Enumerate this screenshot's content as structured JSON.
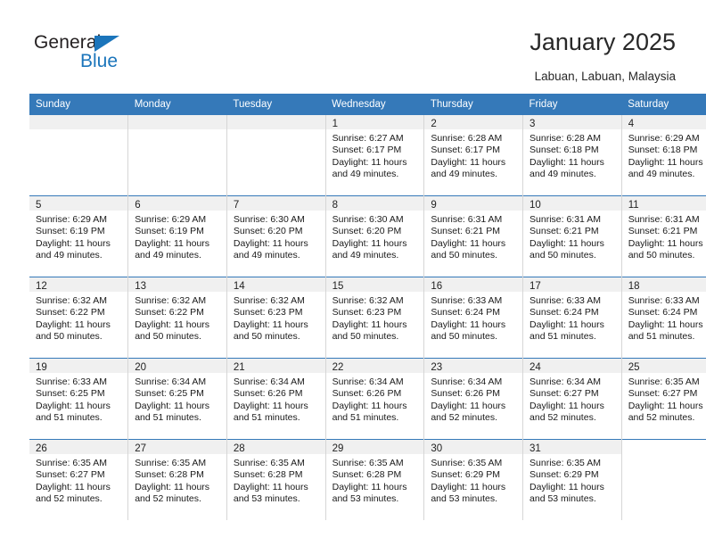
{
  "brand": {
    "name_part1": "General",
    "name_part2": "Blue",
    "triangle_icon": "triangle-icon",
    "accent_color": "#1b75bb"
  },
  "header": {
    "title": "January 2025",
    "location": "Labuan, Labuan, Malaysia"
  },
  "colors": {
    "header_blue": "#3579b9",
    "daynum_band": "#f0f0f0",
    "separator_blue": "#3579b9",
    "cell_divider": "#d6d6d6"
  },
  "weekday_headers": [
    "Sunday",
    "Monday",
    "Tuesday",
    "Wednesday",
    "Thursday",
    "Friday",
    "Saturday"
  ],
  "weeks": [
    [
      {
        "day": "",
        "sunrise": "",
        "sunset": "",
        "daylight_line1": "",
        "daylight_line2": "",
        "blank": true
      },
      {
        "day": "",
        "sunrise": "",
        "sunset": "",
        "daylight_line1": "",
        "daylight_line2": "",
        "blank": true
      },
      {
        "day": "",
        "sunrise": "",
        "sunset": "",
        "daylight_line1": "",
        "daylight_line2": "",
        "blank": true
      },
      {
        "day": "1",
        "sunrise": "Sunrise: 6:27 AM",
        "sunset": "Sunset: 6:17 PM",
        "daylight_line1": "Daylight: 11 hours",
        "daylight_line2": "and 49 minutes."
      },
      {
        "day": "2",
        "sunrise": "Sunrise: 6:28 AM",
        "sunset": "Sunset: 6:17 PM",
        "daylight_line1": "Daylight: 11 hours",
        "daylight_line2": "and 49 minutes."
      },
      {
        "day": "3",
        "sunrise": "Sunrise: 6:28 AM",
        "sunset": "Sunset: 6:18 PM",
        "daylight_line1": "Daylight: 11 hours",
        "daylight_line2": "and 49 minutes."
      },
      {
        "day": "4",
        "sunrise": "Sunrise: 6:29 AM",
        "sunset": "Sunset: 6:18 PM",
        "daylight_line1": "Daylight: 11 hours",
        "daylight_line2": "and 49 minutes."
      }
    ],
    [
      {
        "day": "5",
        "sunrise": "Sunrise: 6:29 AM",
        "sunset": "Sunset: 6:19 PM",
        "daylight_line1": "Daylight: 11 hours",
        "daylight_line2": "and 49 minutes."
      },
      {
        "day": "6",
        "sunrise": "Sunrise: 6:29 AM",
        "sunset": "Sunset: 6:19 PM",
        "daylight_line1": "Daylight: 11 hours",
        "daylight_line2": "and 49 minutes."
      },
      {
        "day": "7",
        "sunrise": "Sunrise: 6:30 AM",
        "sunset": "Sunset: 6:20 PM",
        "daylight_line1": "Daylight: 11 hours",
        "daylight_line2": "and 49 minutes."
      },
      {
        "day": "8",
        "sunrise": "Sunrise: 6:30 AM",
        "sunset": "Sunset: 6:20 PM",
        "daylight_line1": "Daylight: 11 hours",
        "daylight_line2": "and 49 minutes."
      },
      {
        "day": "9",
        "sunrise": "Sunrise: 6:31 AM",
        "sunset": "Sunset: 6:21 PM",
        "daylight_line1": "Daylight: 11 hours",
        "daylight_line2": "and 50 minutes."
      },
      {
        "day": "10",
        "sunrise": "Sunrise: 6:31 AM",
        "sunset": "Sunset: 6:21 PM",
        "daylight_line1": "Daylight: 11 hours",
        "daylight_line2": "and 50 minutes."
      },
      {
        "day": "11",
        "sunrise": "Sunrise: 6:31 AM",
        "sunset": "Sunset: 6:21 PM",
        "daylight_line1": "Daylight: 11 hours",
        "daylight_line2": "and 50 minutes."
      }
    ],
    [
      {
        "day": "12",
        "sunrise": "Sunrise: 6:32 AM",
        "sunset": "Sunset: 6:22 PM",
        "daylight_line1": "Daylight: 11 hours",
        "daylight_line2": "and 50 minutes."
      },
      {
        "day": "13",
        "sunrise": "Sunrise: 6:32 AM",
        "sunset": "Sunset: 6:22 PM",
        "daylight_line1": "Daylight: 11 hours",
        "daylight_line2": "and 50 minutes."
      },
      {
        "day": "14",
        "sunrise": "Sunrise: 6:32 AM",
        "sunset": "Sunset: 6:23 PM",
        "daylight_line1": "Daylight: 11 hours",
        "daylight_line2": "and 50 minutes."
      },
      {
        "day": "15",
        "sunrise": "Sunrise: 6:32 AM",
        "sunset": "Sunset: 6:23 PM",
        "daylight_line1": "Daylight: 11 hours",
        "daylight_line2": "and 50 minutes."
      },
      {
        "day": "16",
        "sunrise": "Sunrise: 6:33 AM",
        "sunset": "Sunset: 6:24 PM",
        "daylight_line1": "Daylight: 11 hours",
        "daylight_line2": "and 50 minutes."
      },
      {
        "day": "17",
        "sunrise": "Sunrise: 6:33 AM",
        "sunset": "Sunset: 6:24 PM",
        "daylight_line1": "Daylight: 11 hours",
        "daylight_line2": "and 51 minutes."
      },
      {
        "day": "18",
        "sunrise": "Sunrise: 6:33 AM",
        "sunset": "Sunset: 6:24 PM",
        "daylight_line1": "Daylight: 11 hours",
        "daylight_line2": "and 51 minutes."
      }
    ],
    [
      {
        "day": "19",
        "sunrise": "Sunrise: 6:33 AM",
        "sunset": "Sunset: 6:25 PM",
        "daylight_line1": "Daylight: 11 hours",
        "daylight_line2": "and 51 minutes."
      },
      {
        "day": "20",
        "sunrise": "Sunrise: 6:34 AM",
        "sunset": "Sunset: 6:25 PM",
        "daylight_line1": "Daylight: 11 hours",
        "daylight_line2": "and 51 minutes."
      },
      {
        "day": "21",
        "sunrise": "Sunrise: 6:34 AM",
        "sunset": "Sunset: 6:26 PM",
        "daylight_line1": "Daylight: 11 hours",
        "daylight_line2": "and 51 minutes."
      },
      {
        "day": "22",
        "sunrise": "Sunrise: 6:34 AM",
        "sunset": "Sunset: 6:26 PM",
        "daylight_line1": "Daylight: 11 hours",
        "daylight_line2": "and 51 minutes."
      },
      {
        "day": "23",
        "sunrise": "Sunrise: 6:34 AM",
        "sunset": "Sunset: 6:26 PM",
        "daylight_line1": "Daylight: 11 hours",
        "daylight_line2": "and 52 minutes."
      },
      {
        "day": "24",
        "sunrise": "Sunrise: 6:34 AM",
        "sunset": "Sunset: 6:27 PM",
        "daylight_line1": "Daylight: 11 hours",
        "daylight_line2": "and 52 minutes."
      },
      {
        "day": "25",
        "sunrise": "Sunrise: 6:35 AM",
        "sunset": "Sunset: 6:27 PM",
        "daylight_line1": "Daylight: 11 hours",
        "daylight_line2": "and 52 minutes."
      }
    ],
    [
      {
        "day": "26",
        "sunrise": "Sunrise: 6:35 AM",
        "sunset": "Sunset: 6:27 PM",
        "daylight_line1": "Daylight: 11 hours",
        "daylight_line2": "and 52 minutes."
      },
      {
        "day": "27",
        "sunrise": "Sunrise: 6:35 AM",
        "sunset": "Sunset: 6:28 PM",
        "daylight_line1": "Daylight: 11 hours",
        "daylight_line2": "and 52 minutes."
      },
      {
        "day": "28",
        "sunrise": "Sunrise: 6:35 AM",
        "sunset": "Sunset: 6:28 PM",
        "daylight_line1": "Daylight: 11 hours",
        "daylight_line2": "and 53 minutes."
      },
      {
        "day": "29",
        "sunrise": "Sunrise: 6:35 AM",
        "sunset": "Sunset: 6:28 PM",
        "daylight_line1": "Daylight: 11 hours",
        "daylight_line2": "and 53 minutes."
      },
      {
        "day": "30",
        "sunrise": "Sunrise: 6:35 AM",
        "sunset": "Sunset: 6:29 PM",
        "daylight_line1": "Daylight: 11 hours",
        "daylight_line2": "and 53 minutes."
      },
      {
        "day": "31",
        "sunrise": "Sunrise: 6:35 AM",
        "sunset": "Sunset: 6:29 PM",
        "daylight_line1": "Daylight: 11 hours",
        "daylight_line2": "and 53 minutes."
      },
      {
        "day": "",
        "sunrise": "",
        "sunset": "",
        "daylight_line1": "",
        "daylight_line2": "",
        "blank": true
      }
    ]
  ]
}
